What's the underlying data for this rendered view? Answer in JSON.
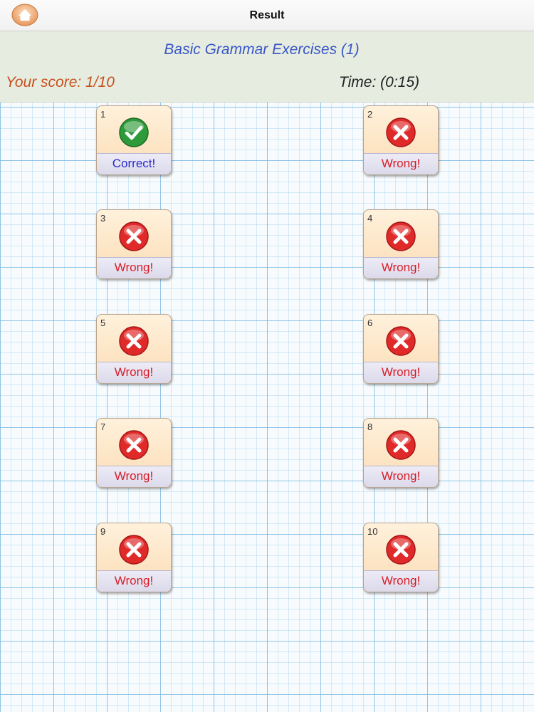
{
  "nav": {
    "title": "Result",
    "home_icon": "home-icon"
  },
  "header": {
    "exercise_title": "Basic Grammar Exercises (1)",
    "score": "Your score: 1/10",
    "time": "Time: (0:15)"
  },
  "colors": {
    "correct": "#2a2ad0",
    "wrong": "#d81e2a",
    "score_text": "#c8501e",
    "title_text": "#3a57c8"
  },
  "results": [
    {
      "number": "1",
      "status": "correct",
      "label": "Correct!",
      "icon": "check-icon"
    },
    {
      "number": "2",
      "status": "wrong",
      "label": "Wrong!",
      "icon": "x-icon"
    },
    {
      "number": "3",
      "status": "wrong",
      "label": "Wrong!",
      "icon": "x-icon"
    },
    {
      "number": "4",
      "status": "wrong",
      "label": "Wrong!",
      "icon": "x-icon"
    },
    {
      "number": "5",
      "status": "wrong",
      "label": "Wrong!",
      "icon": "x-icon"
    },
    {
      "number": "6",
      "status": "wrong",
      "label": "Wrong!",
      "icon": "x-icon"
    },
    {
      "number": "7",
      "status": "wrong",
      "label": "Wrong!",
      "icon": "x-icon"
    },
    {
      "number": "8",
      "status": "wrong",
      "label": "Wrong!",
      "icon": "x-icon"
    },
    {
      "number": "9",
      "status": "wrong",
      "label": "Wrong!",
      "icon": "x-icon"
    },
    {
      "number": "10",
      "status": "wrong",
      "label": "Wrong!",
      "icon": "x-icon"
    }
  ]
}
